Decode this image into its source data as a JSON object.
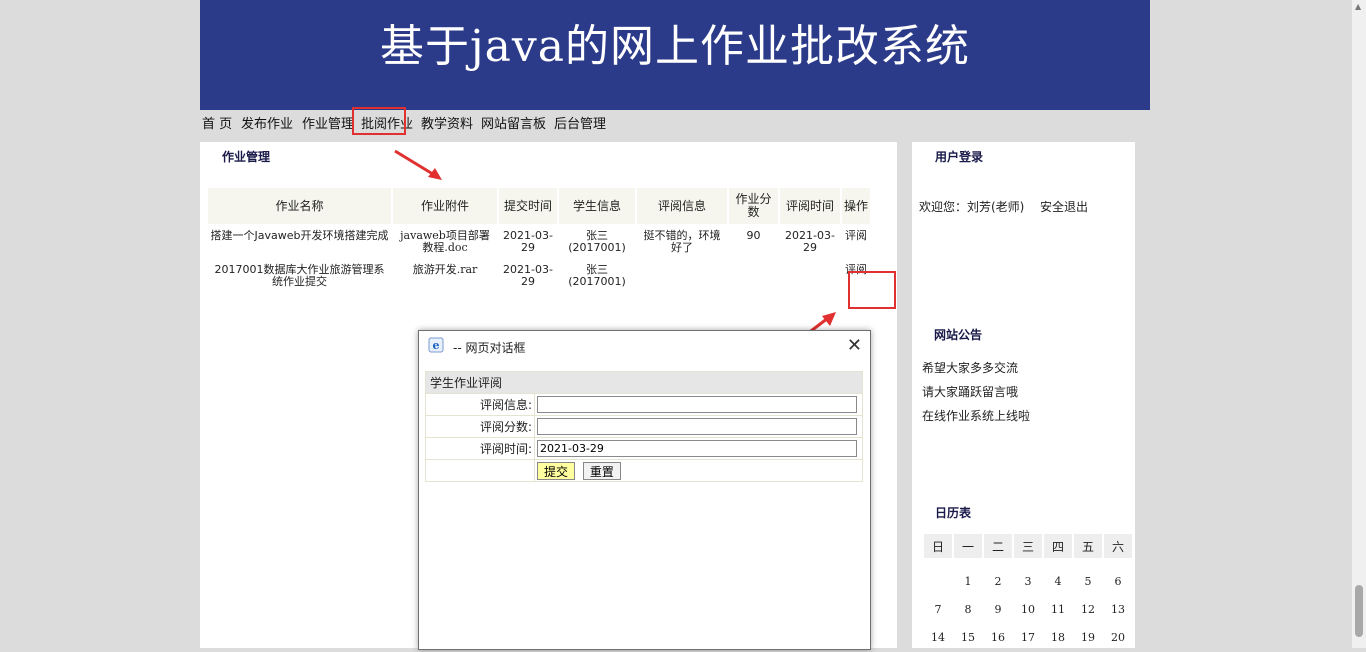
{
  "banner": {
    "title": "基于java的网上作业批改系统"
  },
  "nav": {
    "items": [
      "首 页",
      "发布作业",
      "作业管理",
      "批阅作业",
      "教学资料",
      "网站留言板",
      "后台管理"
    ],
    "active_index": 3
  },
  "main": {
    "section_title": "作业管理",
    "table": {
      "headers": [
        "作业名称",
        "作业附件",
        "提交时间",
        "学生信息",
        "评阅信息",
        "作业分数",
        "评阅时间",
        "操作"
      ],
      "rows": [
        {
          "name": "搭建一个Javaweb开发环境搭建完成",
          "attachment": "javaweb项目部署教程.doc",
          "submit_time": "2021-03-29",
          "student": "张三(2017001)",
          "review_info": "挺不错的，环境好了",
          "score": "90",
          "review_time": "2021-03-29",
          "action": "评阅"
        },
        {
          "name": "2017001数据库大作业旅游管理系统作业提交",
          "attachment": "旅游开发.rar",
          "submit_time": "2021-03-29",
          "student": "张三(2017001)",
          "review_info": "",
          "score": "",
          "review_time": "",
          "action": "评阅"
        }
      ]
    }
  },
  "sidebar": {
    "login_title": "用户登录",
    "welcome": "欢迎您：刘芳(老师)",
    "logout": "安全退出",
    "notice_title": "网站公告",
    "notices": [
      "希望大家多多交流",
      "请大家踊跃留言哦",
      "在线作业系统上线啦"
    ],
    "calendar_title": "日历表",
    "weekdays": [
      "日",
      "一",
      "二",
      "三",
      "四",
      "五",
      "六"
    ],
    "weeks": [
      [
        "",
        "1",
        "2",
        "3",
        "4",
        "5",
        "6"
      ],
      [
        "7",
        "8",
        "9",
        "10",
        "11",
        "12",
        "13"
      ],
      [
        "14",
        "15",
        "16",
        "17",
        "18",
        "19",
        "20"
      ]
    ]
  },
  "dialog": {
    "title": "-- 网页对话框",
    "form_title": "学生作业评阅",
    "fields": {
      "review_info_label": "评阅信息:",
      "review_info_value": "",
      "score_label": "评阅分数:",
      "score_value": "",
      "time_label": "评阅时间:",
      "time_value": "2021-03-29"
    },
    "submit_label": "提交",
    "reset_label": "重置"
  },
  "colors": {
    "banner_bg": "#2b3b8a",
    "highlight": "#e03030",
    "link_red": "#d21d1d"
  }
}
